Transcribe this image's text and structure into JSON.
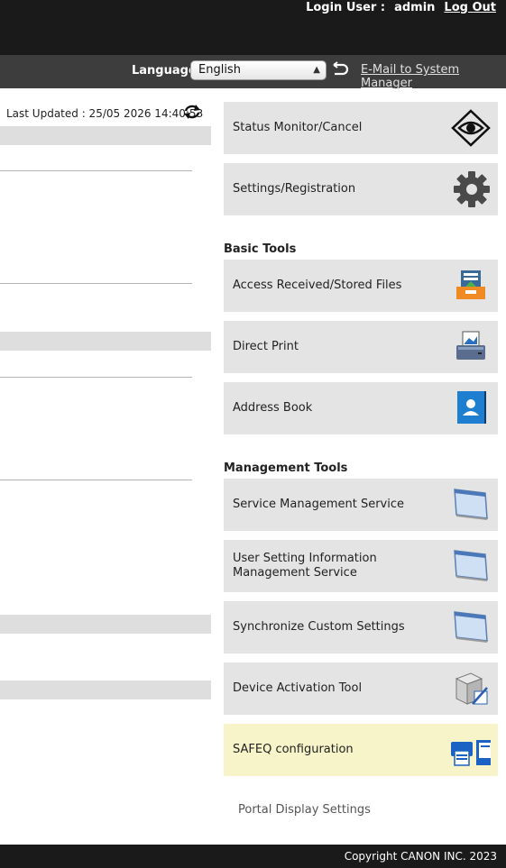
{
  "header": {
    "login_user_label": "Login User :",
    "username": "admin",
    "logout_label": "Log Out",
    "language_label": "Language:",
    "language_value": "English",
    "email_link": "E-Mail to System Manager"
  },
  "left": {
    "last_updated": "Last Updated : 25/05 2026 14:40:53"
  },
  "tiles_top": [
    {
      "label": "Status Monitor/Cancel",
      "icon": "eye-icon"
    },
    {
      "label": "Settings/Registration",
      "icon": "gear-icon"
    }
  ],
  "basic_tools": {
    "title": "Basic Tools",
    "items": [
      {
        "label": "Access Received/Stored Files",
        "icon": "file-box-icon"
      },
      {
        "label": "Direct Print",
        "icon": "printer-icon"
      },
      {
        "label": "Address Book",
        "icon": "address-book-icon"
      }
    ]
  },
  "management_tools": {
    "title": "Management Tools",
    "items": [
      {
        "label": "Service Management Service",
        "icon": "window-icon"
      },
      {
        "label": "User Setting Information Management Service",
        "icon": "window-icon"
      },
      {
        "label": "Synchronize Custom Settings",
        "icon": "window-icon"
      },
      {
        "label": "Device Activation Tool",
        "icon": "device-activation-icon"
      },
      {
        "label": "SAFEQ configuration",
        "icon": "safeq-icon"
      }
    ]
  },
  "portal_display_settings": "Portal Display Settings",
  "footer": {
    "copyright": "Copyright CANON INC. 2023"
  },
  "colors": {
    "header_bg": "#1a1a1a",
    "language_bar_bg": "#3d3d3d",
    "tile_bg": "#e4e4e4",
    "highlight_tile_bg": "#f6f4c8",
    "accent_blue": "#1e6fc0"
  }
}
